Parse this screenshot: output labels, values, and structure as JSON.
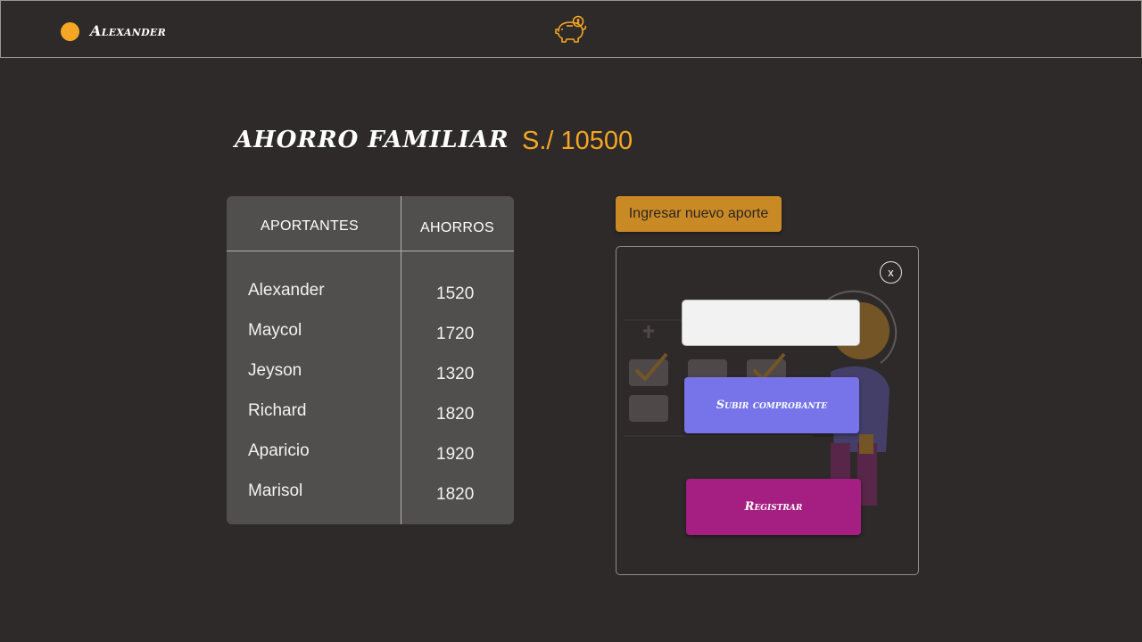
{
  "header": {
    "user_name": "Alexander",
    "logo_icon": "piggy-bank-icon",
    "user_dot_color": "#f5a623"
  },
  "main": {
    "title": "AHORRO FAMILIAR",
    "total": "S./ 10500"
  },
  "table": {
    "headers": [
      "APORTANTES",
      "AHORROS"
    ],
    "rows": [
      {
        "name": "Alexander",
        "amount": "1520"
      },
      {
        "name": "Maycol",
        "amount": "1720"
      },
      {
        "name": "Jeyson",
        "amount": "1320"
      },
      {
        "name": "Richard",
        "amount": "1820"
      },
      {
        "name": "Aparicio",
        "amount": "1920"
      },
      {
        "name": "Marisol",
        "amount": "1820"
      }
    ]
  },
  "contribution": {
    "new_button_label": "Ingresar nuevo aporte",
    "close_label": "x",
    "input_value": "",
    "upload_label": "Subir comprobante",
    "register_label": "Registrar"
  },
  "colors": {
    "background": "#2e2a29",
    "accent": "#f5a623",
    "new_button": "#c98a25",
    "upload_button": "#7674e8",
    "register_button": "#a51f82",
    "table_bg": "#514e4e"
  }
}
